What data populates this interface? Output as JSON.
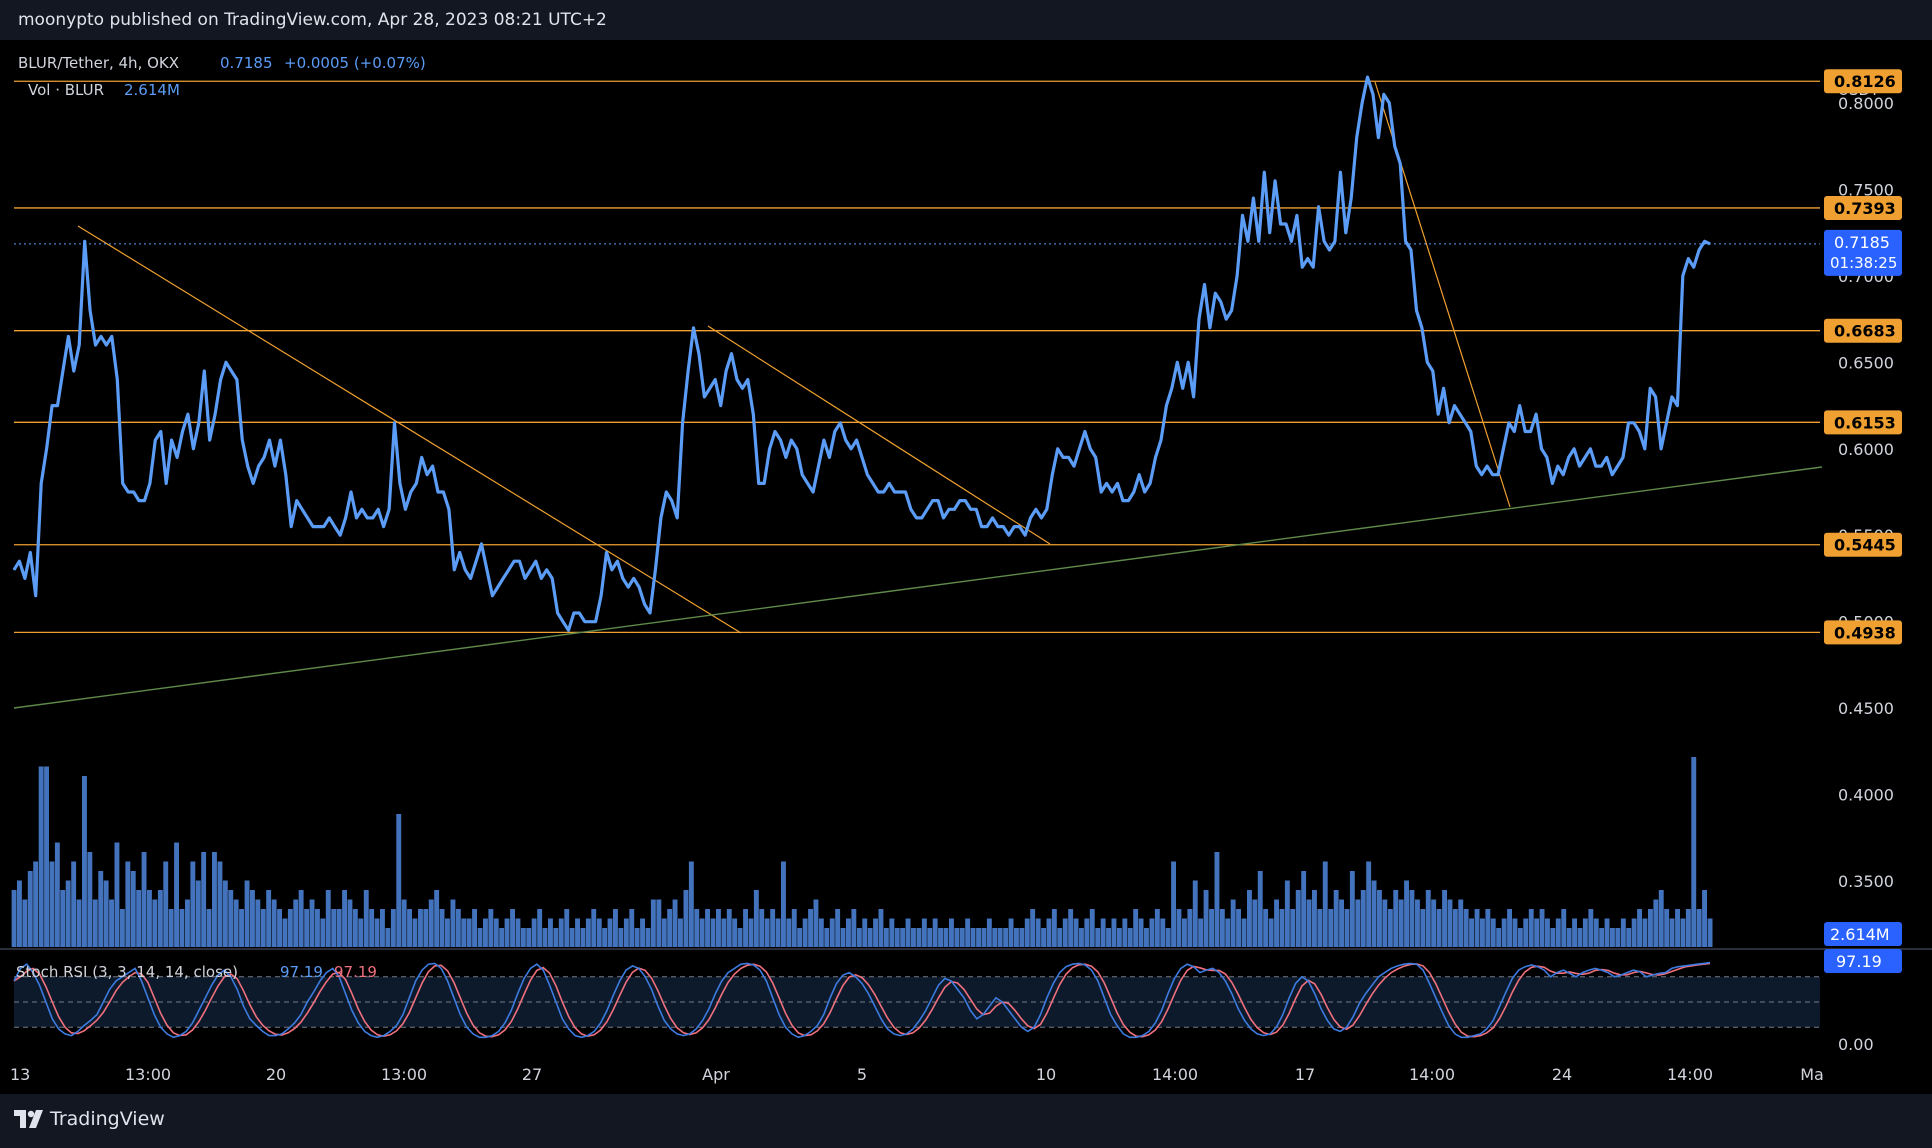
{
  "header": {
    "published": "moonypto published on TradingView.com, Apr 28, 2023 08:21 UTC+2"
  },
  "footer": {
    "brand": "TradingView"
  },
  "legend": {
    "symbol": "BLUR/Tether, 4h, OKX",
    "last": "0.7185",
    "change": "+0.0005 (+0.07%)",
    "vol_label": "Vol · BLUR",
    "vol_value": "2.614M",
    "rsi_label": "Stoch RSI (3, 3, 14, 14, close)",
    "rsi_k": "97.19",
    "rsi_d": "97.19"
  },
  "colors": {
    "price": "#5b9cf6",
    "level": "#f0a030",
    "trendline": "#5f8a4a",
    "volume": "#4a7fd0",
    "rsi_k": "#3d7be0",
    "rsi_d": "#f0707e"
  },
  "chart_data": {
    "type": "line",
    "symbol": "BLUR/Tether",
    "timeframe": "4h",
    "exchange": "OKX",
    "currency": "USDT",
    "price_axis_ticks": [
      "0.8000",
      "0.7500",
      "0.7000",
      "0.6500",
      "0.6000",
      "0.5500",
      "0.5000",
      "0.4500",
      "0.4000",
      "0.3500"
    ],
    "y_range": [
      0.32,
      0.835
    ],
    "x_tick_labels": [
      "13",
      "13:00",
      "20",
      "13:00",
      "27",
      "Apr",
      "5",
      "10",
      "14:00",
      "17",
      "14:00",
      "24",
      "14:00",
      "Ma"
    ],
    "price_series": [
      0.53,
      0.535,
      0.525,
      0.54,
      0.515,
      0.58,
      0.6,
      0.625,
      0.625,
      0.645,
      0.665,
      0.645,
      0.66,
      0.72,
      0.68,
      0.66,
      0.665,
      0.66,
      0.665,
      0.64,
      0.58,
      0.575,
      0.575,
      0.57,
      0.57,
      0.58,
      0.605,
      0.61,
      0.58,
      0.605,
      0.595,
      0.61,
      0.62,
      0.6,
      0.615,
      0.645,
      0.605,
      0.62,
      0.64,
      0.65,
      0.645,
      0.64,
      0.605,
      0.59,
      0.58,
      0.59,
      0.595,
      0.605,
      0.59,
      0.605,
      0.585,
      0.555,
      0.57,
      0.565,
      0.56,
      0.555,
      0.555,
      0.555,
      0.56,
      0.555,
      0.55,
      0.56,
      0.575,
      0.56,
      0.565,
      0.56,
      0.56,
      0.565,
      0.555,
      0.565,
      0.615,
      0.58,
      0.565,
      0.575,
      0.58,
      0.595,
      0.585,
      0.59,
      0.575,
      0.575,
      0.565,
      0.53,
      0.54,
      0.53,
      0.525,
      0.535,
      0.545,
      0.53,
      0.515,
      0.52,
      0.525,
      0.53,
      0.535,
      0.535,
      0.525,
      0.53,
      0.535,
      0.525,
      0.53,
      0.525,
      0.505,
      0.5,
      0.495,
      0.505,
      0.505,
      0.5,
      0.5,
      0.5,
      0.515,
      0.54,
      0.53,
      0.535,
      0.525,
      0.52,
      0.525,
      0.52,
      0.51,
      0.505,
      0.53,
      0.56,
      0.575,
      0.57,
      0.56,
      0.615,
      0.645,
      0.67,
      0.655,
      0.63,
      0.635,
      0.64,
      0.625,
      0.645,
      0.655,
      0.64,
      0.635,
      0.64,
      0.62,
      0.58,
      0.58,
      0.6,
      0.61,
      0.605,
      0.595,
      0.605,
      0.6,
      0.585,
      0.58,
      0.575,
      0.59,
      0.605,
      0.595,
      0.61,
      0.615,
      0.605,
      0.6,
      0.605,
      0.595,
      0.585,
      0.58,
      0.575,
      0.575,
      0.58,
      0.575,
      0.575,
      0.575,
      0.565,
      0.56,
      0.56,
      0.565,
      0.57,
      0.57,
      0.56,
      0.565,
      0.565,
      0.57,
      0.57,
      0.565,
      0.565,
      0.555,
      0.555,
      0.56,
      0.555,
      0.555,
      0.55,
      0.555,
      0.555,
      0.55,
      0.56,
      0.565,
      0.56,
      0.565,
      0.585,
      0.6,
      0.595,
      0.595,
      0.59,
      0.6,
      0.61,
      0.6,
      0.595,
      0.575,
      0.58,
      0.575,
      0.58,
      0.57,
      0.57,
      0.575,
      0.585,
      0.575,
      0.58,
      0.595,
      0.605,
      0.625,
      0.635,
      0.65,
      0.635,
      0.65,
      0.63,
      0.675,
      0.695,
      0.67,
      0.69,
      0.685,
      0.675,
      0.68,
      0.7,
      0.735,
      0.72,
      0.745,
      0.72,
      0.76,
      0.725,
      0.755,
      0.73,
      0.73,
      0.72,
      0.735,
      0.705,
      0.71,
      0.705,
      0.74,
      0.72,
      0.715,
      0.72,
      0.76,
      0.725,
      0.745,
      0.78,
      0.8,
      0.815,
      0.805,
      0.78,
      0.805,
      0.8,
      0.775,
      0.765,
      0.72,
      0.715,
      0.68,
      0.67,
      0.65,
      0.645,
      0.62,
      0.635,
      0.615,
      0.625,
      0.62,
      0.615,
      0.61,
      0.59,
      0.585,
      0.59,
      0.585,
      0.585,
      0.6,
      0.615,
      0.61,
      0.625,
      0.61,
      0.61,
      0.62,
      0.6,
      0.595,
      0.58,
      0.59,
      0.585,
      0.595,
      0.6,
      0.59,
      0.595,
      0.6,
      0.59,
      0.59,
      0.595,
      0.585,
      0.59,
      0.595,
      0.615,
      0.615,
      0.61,
      0.6,
      0.635,
      0.63,
      0.6,
      0.615,
      0.63,
      0.625,
      0.7,
      0.71,
      0.705,
      0.715,
      0.72,
      0.7185
    ],
    "horizontal_levels": [
      0.8126,
      0.7393,
      0.6683,
      0.6153,
      0.5445,
      0.4938
    ],
    "level_labels": [
      "0.8126",
      "0.7393",
      "0.6683",
      "0.6153",
      "0.5445",
      "0.4938"
    ],
    "current_price_label": "0.7185",
    "countdown": "01:38:25",
    "volume_last_label": "2.614M",
    "volume_series": [
      0.3,
      0.35,
      0.25,
      0.4,
      0.45,
      0.95,
      0.95,
      0.45,
      0.55,
      0.3,
      0.35,
      0.45,
      0.25,
      0.9,
      0.5,
      0.25,
      0.4,
      0.35,
      0.25,
      0.55,
      0.2,
      0.45,
      0.4,
      0.3,
      0.5,
      0.3,
      0.25,
      0.3,
      0.45,
      0.2,
      0.55,
      0.2,
      0.25,
      0.45,
      0.35,
      0.5,
      0.2,
      0.5,
      0.45,
      0.35,
      0.3,
      0.25,
      0.2,
      0.35,
      0.3,
      0.25,
      0.2,
      0.3,
      0.25,
      0.2,
      0.15,
      0.2,
      0.25,
      0.3,
      0.2,
      0.25,
      0.2,
      0.15,
      0.3,
      0.2,
      0.2,
      0.3,
      0.25,
      0.2,
      0.15,
      0.3,
      0.2,
      0.15,
      0.2,
      0.1,
      0.2,
      0.7,
      0.25,
      0.2,
      0.15,
      0.2,
      0.2,
      0.25,
      0.3,
      0.2,
      0.15,
      0.25,
      0.2,
      0.15,
      0.15,
      0.2,
      0.1,
      0.15,
      0.2,
      0.15,
      0.1,
      0.15,
      0.2,
      0.15,
      0.1,
      0.1,
      0.15,
      0.2,
      0.1,
      0.15,
      0.1,
      0.15,
      0.2,
      0.1,
      0.15,
      0.1,
      0.15,
      0.2,
      0.15,
      0.1,
      0.15,
      0.2,
      0.1,
      0.15,
      0.2,
      0.1,
      0.15,
      0.1,
      0.25,
      0.25,
      0.15,
      0.2,
      0.25,
      0.15,
      0.3,
      0.45,
      0.2,
      0.15,
      0.2,
      0.15,
      0.2,
      0.15,
      0.2,
      0.15,
      0.1,
      0.2,
      0.15,
      0.3,
      0.2,
      0.15,
      0.2,
      0.15,
      0.45,
      0.15,
      0.2,
      0.1,
      0.15,
      0.2,
      0.25,
      0.15,
      0.1,
      0.15,
      0.2,
      0.1,
      0.15,
      0.2,
      0.1,
      0.15,
      0.1,
      0.15,
      0.2,
      0.1,
      0.15,
      0.1,
      0.1,
      0.15,
      0.1,
      0.1,
      0.15,
      0.1,
      0.15,
      0.1,
      0.1,
      0.15,
      0.1,
      0.1,
      0.15,
      0.1,
      0.1,
      0.1,
      0.15,
      0.1,
      0.1,
      0.1,
      0.15,
      0.1,
      0.1,
      0.15,
      0.2,
      0.15,
      0.1,
      0.15,
      0.2,
      0.1,
      0.15,
      0.2,
      0.15,
      0.1,
      0.15,
      0.2,
      0.1,
      0.15,
      0.1,
      0.15,
      0.1,
      0.15,
      0.1,
      0.2,
      0.15,
      0.1,
      0.15,
      0.2,
      0.15,
      0.1,
      0.45,
      0.2,
      0.15,
      0.2,
      0.35,
      0.15,
      0.3,
      0.2,
      0.5,
      0.2,
      0.15,
      0.25,
      0.2,
      0.15,
      0.3,
      0.25,
      0.4,
      0.2,
      0.15,
      0.25,
      0.2,
      0.35,
      0.2,
      0.3,
      0.4,
      0.25,
      0.3,
      0.2,
      0.45,
      0.2,
      0.3,
      0.25,
      0.2,
      0.4,
      0.25,
      0.3,
      0.45,
      0.35,
      0.3,
      0.25,
      0.2,
      0.3,
      0.25,
      0.35,
      0.3,
      0.25,
      0.2,
      0.3,
      0.25,
      0.2,
      0.3,
      0.25,
      0.2,
      0.25,
      0.2,
      0.15,
      0.2,
      0.15,
      0.2,
      0.15,
      0.1,
      0.15,
      0.2,
      0.15,
      0.1,
      0.15,
      0.2,
      0.15,
      0.2,
      0.15,
      0.1,
      0.15,
      0.2,
      0.1,
      0.15,
      0.1,
      0.15,
      0.2,
      0.15,
      0.1,
      0.15,
      0.1,
      0.1,
      0.15,
      0.1,
      0.15,
      0.2,
      0.15,
      0.2,
      0.25,
      0.3,
      0.2,
      0.15,
      0.2,
      0.15,
      0.2,
      1.0,
      0.2,
      0.3,
      0.15
    ],
    "volume_axis_max_approx": 0.45,
    "stoch_rsi": {
      "k_last": 97.19,
      "d_last": 97.19,
      "bands": [
        80,
        20
      ],
      "k_series": [
        75,
        90,
        95,
        85,
        70,
        50,
        30,
        18,
        12,
        10,
        15,
        22,
        28,
        35,
        50,
        65,
        75,
        80,
        85,
        90,
        75,
        55,
        35,
        20,
        12,
        8,
        10,
        15,
        25,
        40,
        55,
        70,
        82,
        88,
        80,
        65,
        45,
        30,
        22,
        15,
        10,
        10,
        12,
        18,
        25,
        35,
        50,
        62,
        75,
        85,
        90,
        80,
        60,
        40,
        25,
        15,
        10,
        8,
        10,
        15,
        22,
        35,
        55,
        75,
        88,
        95,
        96,
        90,
        75,
        55,
        35,
        20,
        12,
        8,
        8,
        10,
        15,
        25,
        40,
        60,
        78,
        90,
        95,
        88,
        70,
        50,
        30,
        18,
        10,
        8,
        10,
        15,
        25,
        40,
        58,
        75,
        88,
        93,
        90,
        80,
        65,
        45,
        28,
        18,
        12,
        10,
        12,
        18,
        28,
        42,
        60,
        75,
        85,
        90,
        95,
        96,
        94,
        88,
        75,
        55,
        35,
        20,
        12,
        8,
        10,
        15,
        22,
        35,
        55,
        72,
        82,
        85,
        80,
        72,
        60,
        45,
        30,
        18,
        12,
        10,
        12,
        18,
        28,
        40,
        55,
        70,
        78,
        75,
        65,
        55,
        40,
        30,
        35,
        45,
        55,
        50,
        40,
        30,
        20,
        15,
        20,
        35,
        55,
        72,
        85,
        92,
        95,
        96,
        94,
        88,
        75,
        55,
        35,
        22,
        12,
        8,
        8,
        10,
        15,
        25,
        40,
        60,
        78,
        90,
        95,
        92,
        85,
        88,
        90,
        85,
        75,
        60,
        42,
        28,
        18,
        12,
        10,
        12,
        20,
        35,
        55,
        72,
        80,
        75,
        60,
        42,
        28,
        18,
        15,
        20,
        32,
        48,
        60,
        70,
        80,
        85,
        90,
        93,
        95,
        96,
        95,
        88,
        72,
        55,
        38,
        22,
        12,
        8,
        8,
        10,
        12,
        18,
        28,
        45,
        62,
        78,
        88,
        92,
        94,
        92,
        88,
        80,
        85,
        88,
        84,
        80,
        85,
        88,
        90,
        88,
        85,
        80,
        82,
        85,
        88,
        86,
        80,
        82,
        84,
        85,
        90,
        92,
        93,
        94,
        95,
        96,
        97
      ]
    }
  }
}
